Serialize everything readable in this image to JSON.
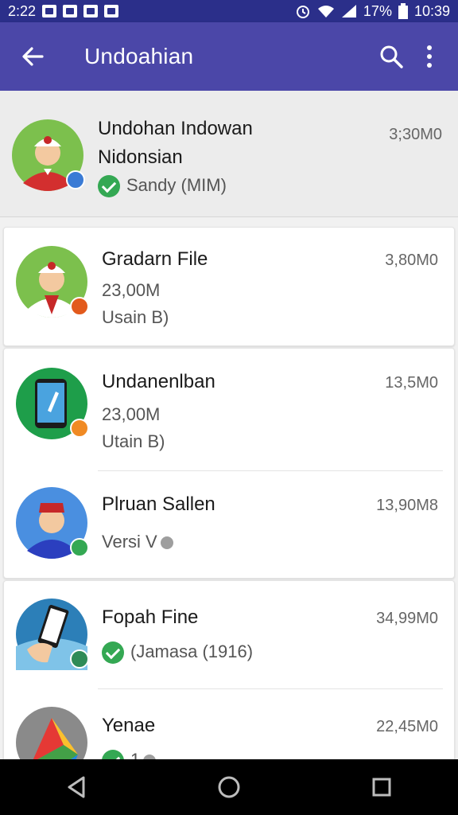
{
  "status_bar": {
    "left_time": "2:22",
    "battery_text": "17%",
    "clock": "10:39"
  },
  "app_bar": {
    "title": "Undoahian",
    "back_icon": "arrow-left-icon",
    "search_icon": "search-icon",
    "more_icon": "more-vert-icon"
  },
  "header_item": {
    "title": "Undohan Indowan",
    "title_line2": "Nidonsian",
    "subtitle": "Sandy (MIM)",
    "time": "3;30M0"
  },
  "items": [
    {
      "title": "Gradarn File",
      "line1": "23,00M",
      "line2": "Usain B)",
      "time": "3,80M0"
    },
    {
      "title": "Undanenlban",
      "line1": "23,00M",
      "line2": "Utain B)",
      "time": "13,5M0"
    },
    {
      "title": "Plruan Sallen",
      "line1": "Versi V",
      "time": "13,90M8"
    },
    {
      "title": "Fopah Fine",
      "line1": "(Jamasa (1916)",
      "time": "34,99M0"
    },
    {
      "title": "Yenae",
      "line1": "1",
      "time": "22,45M0"
    }
  ],
  "nav": {
    "back": "nav-back-icon",
    "home": "nav-home-icon",
    "recents": "nav-recents-icon"
  },
  "colors": {
    "status_bar": "#2b2f8a",
    "app_bar": "#4b47a8",
    "check_green": "#34a853"
  }
}
